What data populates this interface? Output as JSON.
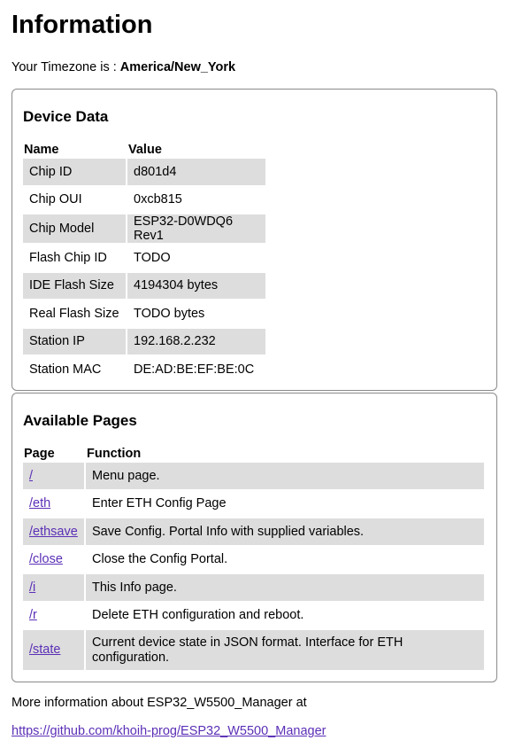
{
  "title": "Information",
  "timezone": {
    "label": "Your Timezone is : ",
    "value": "America/New_York"
  },
  "device": {
    "heading": "Device Data",
    "headers": [
      "Name",
      "Value"
    ],
    "rows": [
      [
        "Chip ID",
        "d801d4"
      ],
      [
        "Chip OUI",
        "0xcb815"
      ],
      [
        "Chip Model",
        "ESP32-D0WDQ6 Rev1"
      ],
      [
        "Flash Chip ID",
        "TODO"
      ],
      [
        "IDE Flash Size",
        "4194304 bytes"
      ],
      [
        "Real Flash Size",
        "TODO bytes"
      ],
      [
        "Station IP",
        "192.168.2.232"
      ],
      [
        "Station MAC",
        "DE:AD:BE:EF:BE:0C"
      ]
    ]
  },
  "pages": {
    "heading": "Available Pages",
    "headers": [
      "Page",
      "Function"
    ],
    "rows": [
      [
        "/",
        "Menu page."
      ],
      [
        "/eth",
        "Enter ETH Config Page"
      ],
      [
        "/ethsave",
        "Save Config. Portal Info with supplied variables."
      ],
      [
        "/close",
        "Close the Config Portal."
      ],
      [
        "/i",
        "This Info page."
      ],
      [
        "/r",
        "Delete ETH configuration and reboot."
      ],
      [
        "/state",
        "Current device state in JSON format. Interface for ETH configuration."
      ]
    ]
  },
  "footer": {
    "more_text": "More information about ESP32_W5500_Manager at",
    "link": "https://github.com/khoih-prog/ESP32_W5500_Manager"
  }
}
